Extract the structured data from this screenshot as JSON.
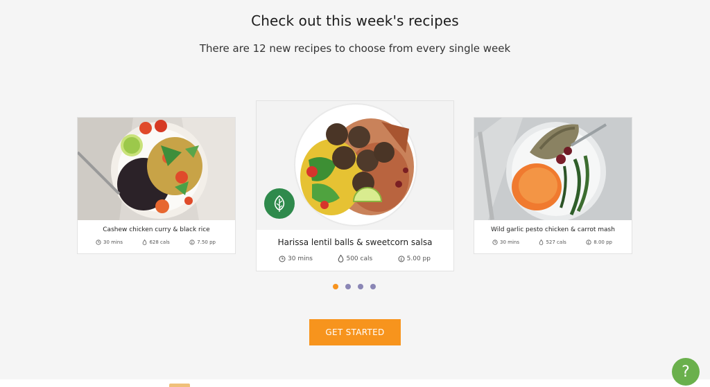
{
  "section": {
    "title": "Check out this week's recipes",
    "subtitle": "There are 12 new recipes to choose from every single week"
  },
  "recipes": [
    {
      "title": "Cashew chicken curry & black rice",
      "time": "30 mins",
      "calories": "628 cals",
      "price": "7.50 pp"
    },
    {
      "title": "Harissa lentil balls & sweetcorn salsa",
      "time": "30 mins",
      "calories": "500 cals",
      "price": "5.00 pp",
      "badge_icon": "leaf-icon"
    },
    {
      "title": "Wild garlic pesto chicken & carrot mash",
      "time": "30 mins",
      "calories": "527 cals",
      "price": "8.00 pp"
    }
  ],
  "carousel": {
    "slide_count": 4,
    "active_index": 0
  },
  "cta": {
    "label": "GET STARTED"
  },
  "help": {
    "label": "?"
  },
  "colors": {
    "accent": "#f7941d",
    "dot_inactive": "#8a86b5",
    "help_green": "#6ab04c",
    "badge_green": "#2f8a4c"
  }
}
